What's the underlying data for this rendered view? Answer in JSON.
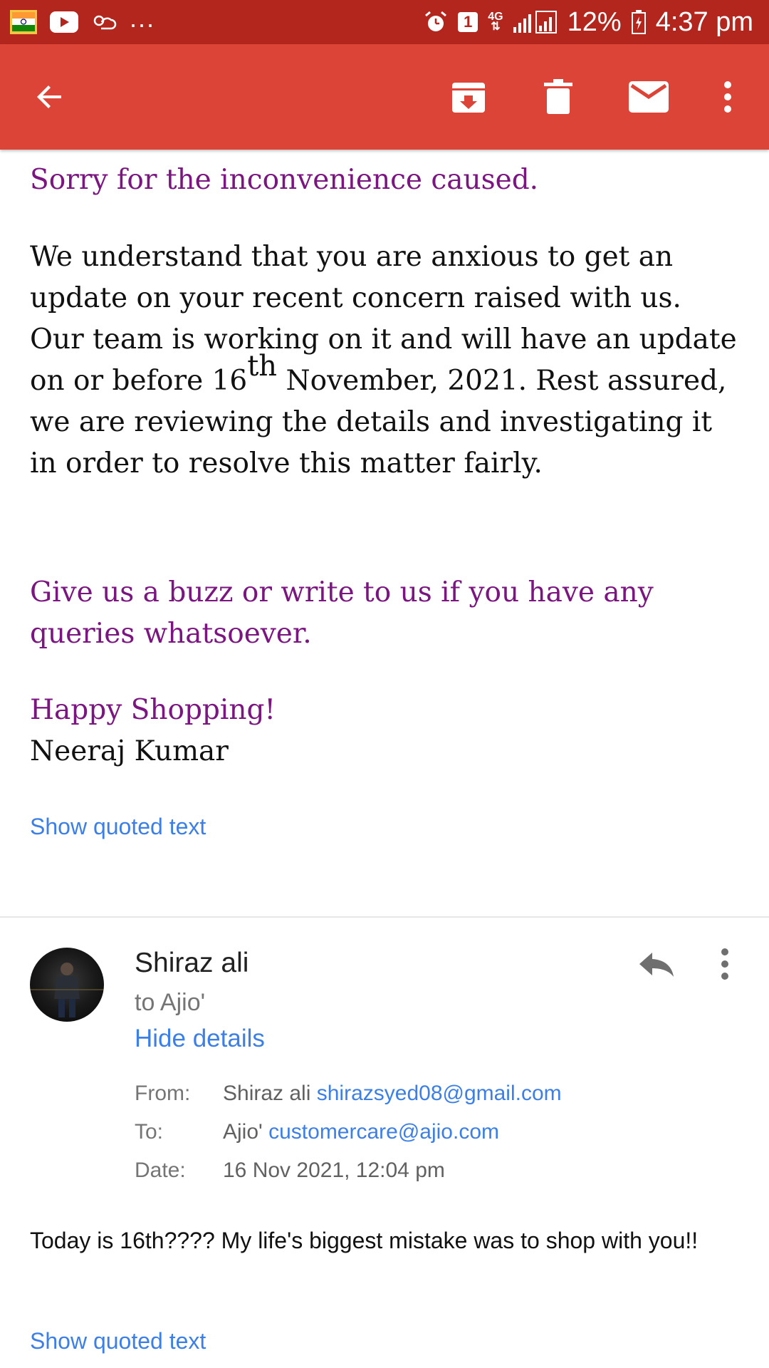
{
  "status_bar": {
    "indicator_1": "1",
    "network": "4G",
    "battery": "12%",
    "time": "4:37 pm",
    "more": "..."
  },
  "app_bar": {
    "icons": [
      "back-arrow-icon",
      "archive-icon",
      "delete-icon",
      "mark-unread-icon",
      "more-vert-icon"
    ]
  },
  "message1": {
    "apology": "Sorry for the inconvenience caused.",
    "body_before": "We understand that you are anxious to get an update on your recent concern raised with us. Our team is working on it and will have an update on or before 16",
    "body_sup": "th",
    "body_after": " November, 2021. Rest assured, we are reviewing the details and investigating it in order to resolve this matter fairly.",
    "cta": "Give us a buzz or write to us if you have any queries whatsoever.",
    "closing": "Happy Shopping!",
    "signature": "Neeraj Kumar",
    "show_quoted": "Show quoted text"
  },
  "message2": {
    "sender": "Shiraz ali",
    "recipient": "to Ajio'",
    "hide_details": "Hide details",
    "details": {
      "from_label": "From:",
      "from_name": "Shiraz ali",
      "from_email": "shirazsyed08@gmail.com",
      "to_label": "To:",
      "to_name": "Ajio'",
      "to_email": "customercare@ajio.com",
      "date_label": "Date:",
      "date_value": "16 Nov 2021, 12:04 pm"
    },
    "body": "Today is 16th???? My life's biggest mistake was to shop with you!!",
    "show_quoted": "Show quoted text"
  },
  "colors": {
    "status_bar": "#b3261e",
    "app_bar": "#db4437",
    "purple_text": "#7b1580",
    "link": "#3c7fe6"
  }
}
